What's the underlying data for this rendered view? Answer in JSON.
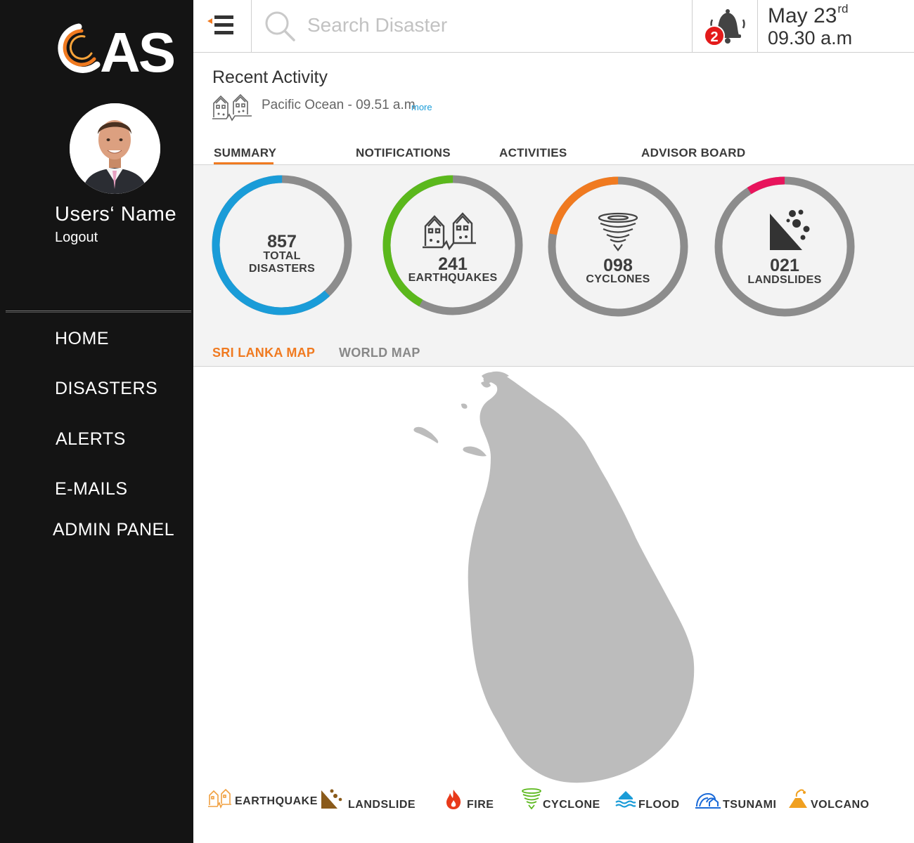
{
  "brand": {
    "logo_text": "AS",
    "accent": "#f07a20"
  },
  "user": {
    "name": "Users‘  Name",
    "logout_label": "Logout"
  },
  "nav": {
    "items": [
      {
        "label": "HOME"
      },
      {
        "label": "DISASTERS"
      },
      {
        "label": "ALERTS"
      },
      {
        "label": "E-MAILS"
      },
      {
        "label": "ADMIN PANEL"
      }
    ]
  },
  "topbar": {
    "search_placeholder": "Search Disaster",
    "notification_count": "2",
    "date": "May 23",
    "date_suffix": "rd",
    "time": "09.30 a.m"
  },
  "recent": {
    "title": "Recent Activity",
    "text": "Pacific Ocean - 09.51 a.m",
    "more_label": "more"
  },
  "tabs": [
    {
      "label": "SUMMARY",
      "active": true
    },
    {
      "label": "NOTIFICATIONS"
    },
    {
      "label": "ACTIVITIES"
    },
    {
      "label": "ADVISOR BOARD"
    }
  ],
  "stats": [
    {
      "value": "857",
      "label_line1": "TOTAL",
      "label_line2": "DISASTERS",
      "color": "#1a9cd8",
      "fraction": 0.62
    },
    {
      "value": "241",
      "label_line1": "EARTHQUAKES",
      "label_line2": "",
      "color": "#5bb81c",
      "fraction": 0.42,
      "icon": "earthquake-icon"
    },
    {
      "value": "098",
      "label_line1": "CYCLONES",
      "label_line2": "",
      "color": "#f07a20",
      "fraction": 0.22,
      "icon": "cyclone-icon"
    },
    {
      "value": "021",
      "label_line1": "LANDSLIDES",
      "label_line2": "",
      "color": "#e8145c",
      "fraction": 0.09,
      "icon": "landslide-icon"
    }
  ],
  "map_tabs": [
    {
      "label": "SRI LANKA MAP",
      "active": true,
      "color": "#f07a20"
    },
    {
      "label": "WORLD MAP",
      "color": "#888888"
    }
  ],
  "legend": [
    {
      "label": "EARTHQUAKE",
      "icon": "earthquake-icon",
      "color": "#f0a040"
    },
    {
      "label": "LANDSLIDE",
      "icon": "landslide-icon",
      "color": "#8a5a1a"
    },
    {
      "label": "FIRE",
      "icon": "fire-icon",
      "color": "#e83a1a"
    },
    {
      "label": "CYCLONE",
      "icon": "cyclone-icon",
      "color": "#5bb81c"
    },
    {
      "label": "FLOOD",
      "icon": "flood-icon",
      "color": "#1a9cd8"
    },
    {
      "label": "TSUNAMI",
      "icon": "tsunami-icon",
      "color": "#1a6ad8"
    },
    {
      "label": "VOLCANO",
      "icon": "volcano-icon",
      "color": "#f0a020"
    }
  ]
}
